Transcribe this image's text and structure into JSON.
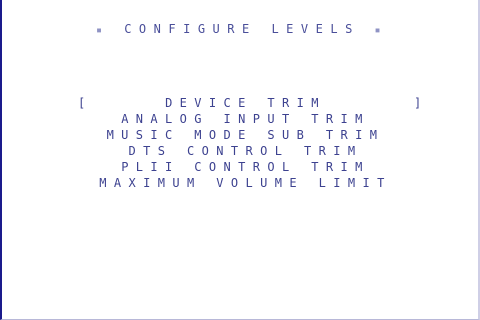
{
  "screen": {
    "title": "CONFIGURE LEVELS",
    "title_marker": "▪"
  },
  "menu": {
    "selected_index": 0,
    "cursor_left": "[",
    "cursor_right": "]",
    "items": [
      {
        "label": "DEVICE TRIM"
      },
      {
        "label": "ANALOG INPUT TRIM"
      },
      {
        "label": "MUSIC MODE SUB TRIM"
      },
      {
        "label": "DTS CONTROL TRIM"
      },
      {
        "label": "PLII CONTROL TRIM"
      },
      {
        "label": "MAXIMUM VOLUME LIMIT"
      }
    ]
  },
  "colors": {
    "background": "#ffffff",
    "text": "#3d4290",
    "border": "#1a1a8c"
  }
}
